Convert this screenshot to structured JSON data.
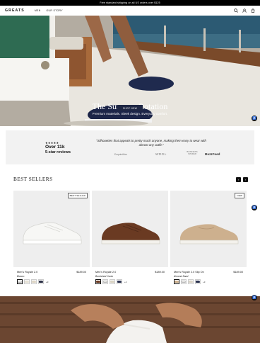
{
  "announcement": "Free standard shipping on all US orders over $125",
  "nav": {
    "logo": "GREATS",
    "links": [
      "MEN",
      "OUR STORY"
    ]
  },
  "hero": {
    "title": "The Summer Rotation",
    "subtitle": "Premium materials. Sleek design. Everyday comfort.",
    "cta": "SHOP NOW"
  },
  "press": {
    "stars": "★★★★★",
    "count": "Over 11k",
    "label": "5-star reviews",
    "quote": "\"Silhouettes that appeals to pretty much anyone, making them easy to wear with almost any outfit.\"",
    "logos": [
      "EsquireMen",
      "WRGL",
      "BUSINESS INSIDER",
      "BuzzFeed"
    ]
  },
  "best_sellers": {
    "title": "BEST SELLERS",
    "prev_icon": "chevron-left-icon",
    "next_icon": "chevron-right-icon",
    "products": [
      {
        "badge": "BEST SELLER",
        "name": "Men's Royale 2.0",
        "price": "$189.00",
        "color": "Blanco",
        "swatches": [
          "#f4f4f2",
          "#e6e2d6",
          "#ddd5c4",
          "#2a2f45"
        ],
        "more": "+3"
      },
      {
        "badge": "",
        "name": "Men's Royale 2.0",
        "price": "$189.00",
        "color": "Burnished Cuoio",
        "swatches": [
          "#6a3a22",
          "#f1f0ec",
          "#d9d3c2",
          "#2b3250"
        ],
        "more": "+4"
      },
      {
        "badge": "NEW",
        "name": "Men's Royale 2.0 Slip On",
        "price": "$189.00",
        "color": "Almond Sand",
        "swatches": [
          "#cdb08e",
          "#f2f1ee",
          "#dad4c6",
          "#2b3250"
        ],
        "more": "+3"
      }
    ]
  },
  "colors": {
    "announcement_bg": "#000000",
    "cta_bg": "#1f2744",
    "press_bg": "#f2f2f2",
    "card_bg": "#eeeeee"
  }
}
